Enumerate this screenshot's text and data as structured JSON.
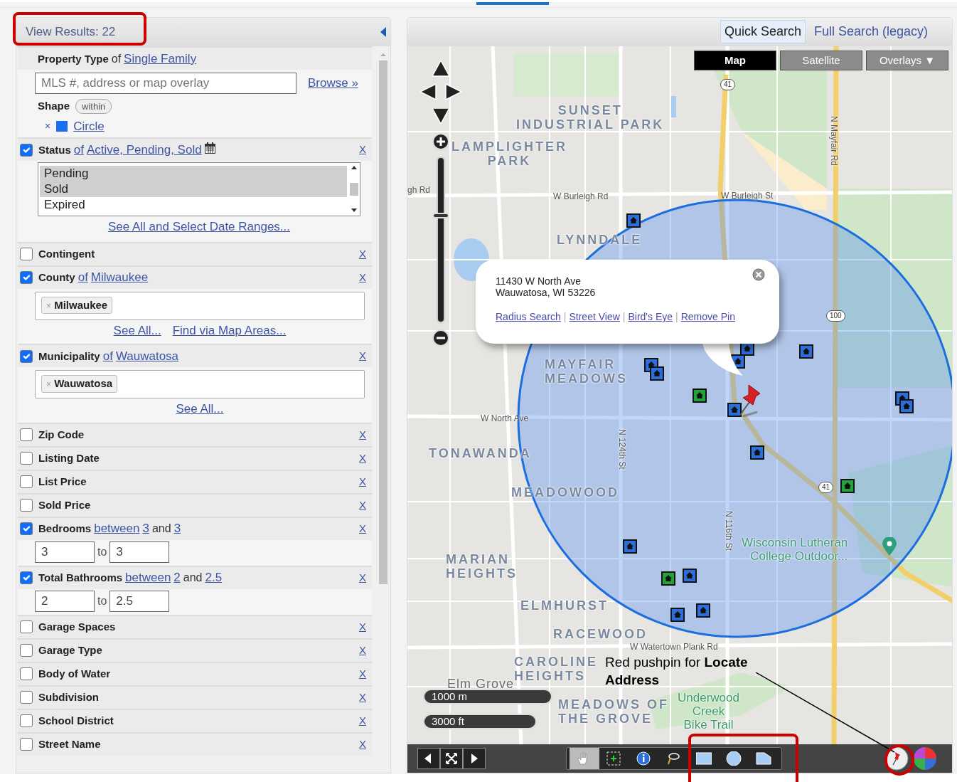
{
  "left_panel": {
    "results_button": "View Results: 22",
    "filters": [
      {
        "kind": "property",
        "label": "Property Type",
        "connector": "of",
        "value": "Single Family",
        "search_placeholder": "MLS #, address or map overlay",
        "browse": "Browse »",
        "shape_label": "Shape",
        "shape_mode": "within",
        "shape_remove": "×",
        "shape_name": "Circle"
      },
      {
        "kind": "list",
        "label": "Status",
        "checked": true,
        "connector": "of",
        "value": "Active, Pending, Sold",
        "remove": "X",
        "options": [
          {
            "text": "Pending",
            "selected": true
          },
          {
            "text": "Sold",
            "selected": true
          },
          {
            "text": "Expired",
            "selected": false
          }
        ],
        "links": [
          "See All and Select Date Ranges..."
        ]
      },
      {
        "kind": "plain",
        "label": "Contingent",
        "checked": false,
        "remove": "X"
      },
      {
        "kind": "tags",
        "label": "County",
        "checked": true,
        "connector": "of",
        "value": "Milwaukee",
        "remove": "X",
        "tags": [
          "× Milwaukee"
        ],
        "links": [
          "See All...",
          "Find via Map Areas..."
        ]
      },
      {
        "kind": "tags",
        "label": "Municipality",
        "checked": true,
        "connector": "of",
        "value": "Wauwatosa",
        "remove": "X",
        "tags": [
          "× Wauwatosa"
        ],
        "links": [
          "See All..."
        ]
      },
      {
        "kind": "plain",
        "label": "Zip Code",
        "checked": false,
        "remove": "X"
      },
      {
        "kind": "plain",
        "label": "Listing Date",
        "checked": false,
        "remove": "X"
      },
      {
        "kind": "plain",
        "label": "List Price",
        "checked": false,
        "remove": "X"
      },
      {
        "kind": "plain",
        "label": "Sold Price",
        "checked": false,
        "remove": "X"
      },
      {
        "kind": "range",
        "label": "Bedrooms",
        "checked": true,
        "connector": "between",
        "min": "3",
        "joiner": "and",
        "max": "3",
        "from": "3",
        "to_label": "to",
        "to": "3",
        "remove": "X"
      },
      {
        "kind": "range",
        "label": "Total Bathrooms",
        "checked": true,
        "connector": "between",
        "min": "2",
        "joiner": "and",
        "max": "2.5",
        "from": "2",
        "to_label": "to",
        "to": "2.5",
        "remove": "X"
      },
      {
        "kind": "plain",
        "label": "Garage Spaces",
        "checked": false,
        "remove": "X"
      },
      {
        "kind": "plain",
        "label": "Garage Type",
        "checked": false,
        "remove": "X"
      },
      {
        "kind": "plain",
        "label": "Body of Water",
        "checked": false,
        "remove": "X"
      },
      {
        "kind": "plain",
        "label": "Subdivision",
        "checked": false,
        "remove": "X"
      },
      {
        "kind": "plain",
        "label": "School District",
        "checked": false,
        "remove": "X"
      },
      {
        "kind": "plain",
        "label": "Street Name",
        "checked": false,
        "remove": "X"
      }
    ]
  },
  "map_panel": {
    "search_tabs": [
      {
        "label": "Quick Search",
        "selected": true
      },
      {
        "label": "Full Search (legacy)",
        "selected": false
      }
    ],
    "map_types": [
      {
        "label": "Map",
        "selected": true
      },
      {
        "label": "Satellite",
        "selected": false
      },
      {
        "label": "Overlays ▼",
        "selected": false
      }
    ],
    "zoom": {
      "level": 0.65
    },
    "labels": [
      {
        "text": "SUNSET\nINDUSTRIAL PARK",
        "kind": "area"
      },
      {
        "text": "LAMPLIGHTER\nPARK",
        "kind": "area"
      },
      {
        "text": "LYNNDALE",
        "kind": "area"
      },
      {
        "text": "MAYFAIR\nMEADOWS",
        "kind": "area"
      },
      {
        "text": "TONAWANDA",
        "kind": "area"
      },
      {
        "text": "MEADOWOOD",
        "kind": "area"
      },
      {
        "text": "MARIAN\nHEIGHTS",
        "kind": "area"
      },
      {
        "text": "ELMHURST",
        "kind": "area"
      },
      {
        "text": "RACEWOOD",
        "kind": "area"
      },
      {
        "text": "CAROLINE\nHEIGHTS",
        "kind": "area"
      },
      {
        "text": "MEADOWS OF\nTHE GROVE",
        "kind": "area"
      },
      {
        "text": "Elm Grove",
        "kind": "town"
      },
      {
        "text": "gh Rd",
        "kind": "road"
      },
      {
        "text": "W Burleigh Rd",
        "kind": "road"
      },
      {
        "text": "W Burleigh St",
        "kind": "road"
      },
      {
        "text": "W North Ave",
        "kind": "road"
      },
      {
        "text": "W Watertown Plank Rd",
        "kind": "road"
      },
      {
        "text": "N 124th St",
        "kind": "road_vertical"
      },
      {
        "text": "N 116th St",
        "kind": "road_vertical"
      },
      {
        "text": "N Mayfair Rd",
        "kind": "road_vertical"
      },
      {
        "text": "Wisconsin Lutheran\nCollege Outdoor...",
        "kind": "poi"
      },
      {
        "text": "Underwood\nCreek\nBike Trail",
        "kind": "park"
      },
      {
        "text": "41",
        "kind": "shield"
      },
      {
        "text": "100",
        "kind": "shield"
      },
      {
        "text": "41",
        "kind": "shield"
      }
    ],
    "markers": [
      {
        "color": "#2a6fdb"
      },
      {
        "color": "#2a6fdb"
      },
      {
        "color": "#2a6fdb"
      },
      {
        "color": "#2a6fdb"
      },
      {
        "color": "#2a6fdb"
      },
      {
        "color": "#2a6fdb"
      },
      {
        "color": "#2a6fdb"
      },
      {
        "color": "#2a6fdb"
      },
      {
        "color": "#2a6fdb"
      },
      {
        "color": "#2a6fdb"
      },
      {
        "color": "#2a6fdb"
      },
      {
        "color": "#2a6fdb"
      },
      {
        "color": "#2a6fdb"
      },
      {
        "color": "#2a6fdb"
      },
      {
        "color": "#22a33a"
      },
      {
        "color": "#22a33a"
      },
      {
        "color": "#22a33a"
      }
    ],
    "popup": {
      "address": [
        "11430 W North Ave",
        "Wauwatosa, WI 53226"
      ],
      "separator": "|",
      "links": [
        "Radius Search",
        "Street View",
        "Bird's Eye",
        "Remove Pin"
      ]
    },
    "scale": [
      "1000 m",
      "3000 ft"
    ],
    "toolbar": {
      "nav": [
        {
          "kind": "previous"
        },
        {
          "kind": "fit"
        },
        {
          "kind": "next"
        }
      ],
      "tools": [
        {
          "kind": "hand",
          "selected": true
        },
        {
          "kind": "zoombox",
          "selected": false
        },
        {
          "kind": "info",
          "selected": false
        },
        {
          "kind": "lasso",
          "selected": false
        },
        {
          "kind": "rectangle",
          "selected": false
        },
        {
          "kind": "circle",
          "selected": false
        },
        {
          "kind": "polygon",
          "selected": false
        }
      ]
    },
    "annotation": "Red pushpin for **Locate Address**"
  }
}
